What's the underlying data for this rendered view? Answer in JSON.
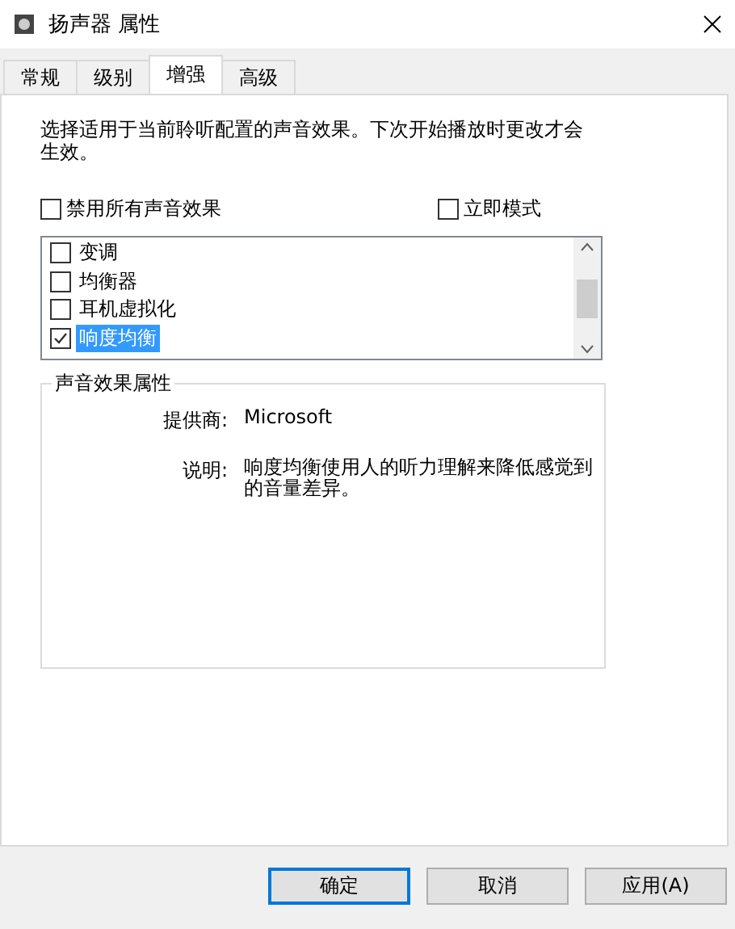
{
  "window": {
    "title": "扬声器 属性"
  },
  "tabs": [
    {
      "label": "常规",
      "selected": false
    },
    {
      "label": "级别",
      "selected": false
    },
    {
      "label": "增强",
      "selected": true
    },
    {
      "label": "高级",
      "selected": false
    }
  ],
  "intro": "选择适用于当前聆听配置的声音效果。下次开始播放时更改才会生效。",
  "options": [
    {
      "label": "禁用所有声音效果",
      "checked": false
    },
    {
      "label": "立即模式",
      "checked": false
    }
  ],
  "effects": [
    {
      "label": "变调",
      "checked": false,
      "selected": false
    },
    {
      "label": "均衡器",
      "checked": false,
      "selected": false
    },
    {
      "label": "耳机虚拟化",
      "checked": false,
      "selected": false
    },
    {
      "label": "响度均衡",
      "checked": true,
      "selected": true
    }
  ],
  "properties": {
    "title": "声音效果属性",
    "rows": [
      {
        "label": "提供商:",
        "value": "Microsoft"
      },
      {
        "label": "说明:",
        "value": "响度均衡使用人的听力理解来降低感觉到的音量差异。"
      }
    ]
  },
  "buttons": [
    {
      "label": "确定",
      "default": true
    },
    {
      "label": "取消",
      "default": false
    },
    {
      "label": "应用(A)",
      "default": false
    }
  ]
}
